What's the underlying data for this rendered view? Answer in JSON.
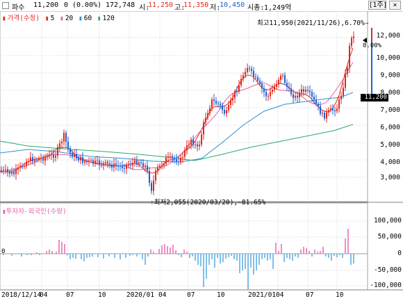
{
  "header": {
    "stock_name": "파수",
    "price": "11,200",
    "change": "0",
    "change_pct": "(0.00%)",
    "volume": "172,748",
    "open_label": "시:",
    "open": "11,250",
    "high_label": "고:",
    "high": "11,350",
    "low_label": "저:",
    "low": "10,450",
    "market_cap_label": "시총:",
    "market_cap": "1,249억",
    "period_button": "1주",
    "close_button": "×"
  },
  "legend": {
    "price_label": "가격(수정)",
    "ma": [
      "5",
      "20",
      "60",
      "120"
    ],
    "ma_colors": [
      "#e1261c",
      "#e85fa4",
      "#2a8fd6",
      "#2ea86a"
    ]
  },
  "price_axis": {
    "labels": [
      "12,000",
      "11,000",
      "10,000",
      "9,000",
      "8,000",
      "7,000",
      "6,000",
      "5,000",
      "4,000",
      "3,000"
    ],
    "current_price": "11,200",
    "current_pct": "0.00%"
  },
  "annotations": {
    "high": "최고11,950(2021/11/26),6.70%",
    "low": "최저2,055(2020/03/20),-81.65%"
  },
  "investor": {
    "label": "투자자-외국인(수량)",
    "axis_labels": [
      "100,000",
      "50,000",
      "0",
      "-50,000",
      "-100,000"
    ],
    "zero_left": "0"
  },
  "x_axis": {
    "labels": [
      "2018/12/14",
      "04",
      "07",
      "10",
      "2020/01",
      "04",
      "07",
      "10",
      "2021/01",
      "04",
      "07",
      "10"
    ]
  },
  "colors": {
    "up": "#e1261c",
    "down": "#1f5fd1",
    "ma5": "#e1261c",
    "ma20": "#e85fa4",
    "ma60": "#2a8fd6",
    "ma120": "#2ea86a",
    "volume_pos": "#f08cc4",
    "volume_neg": "#7fc0ea"
  }
}
